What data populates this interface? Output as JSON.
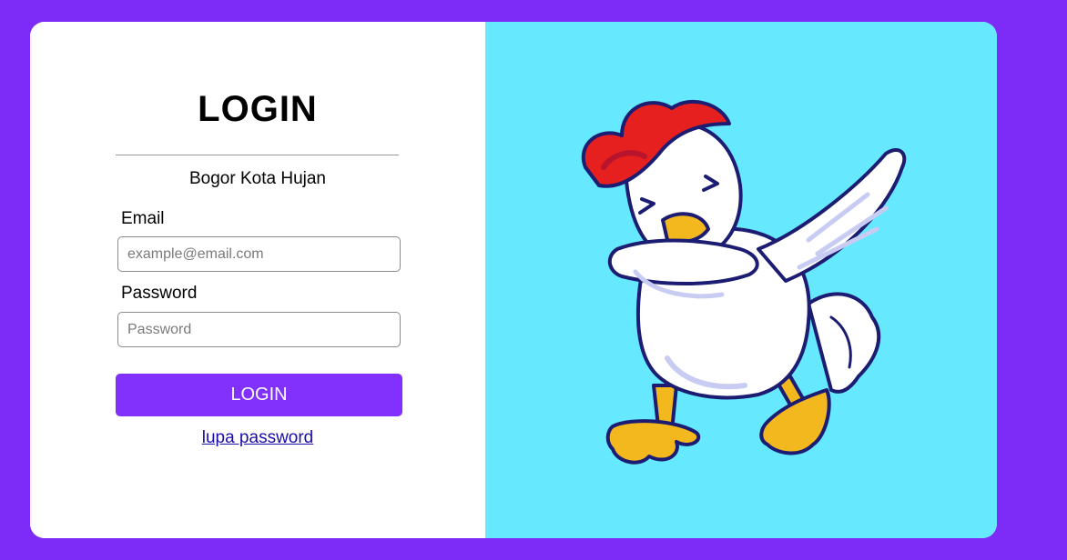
{
  "login": {
    "title": "LOGIN",
    "subtitle": "Bogor Kota Hujan",
    "email_label": "Email",
    "email_placeholder": "example@email.com",
    "password_label": "Password",
    "password_placeholder": "Password",
    "submit_label": "LOGIN",
    "forgot_link": "lupa password"
  },
  "illustration": {
    "subject": "dabbing-chicken-mascot"
  },
  "colors": {
    "page_background": "#7d2cf7",
    "button": "#8230fc",
    "illustration_background": "#66e8ff",
    "link": "#1a0dab"
  }
}
